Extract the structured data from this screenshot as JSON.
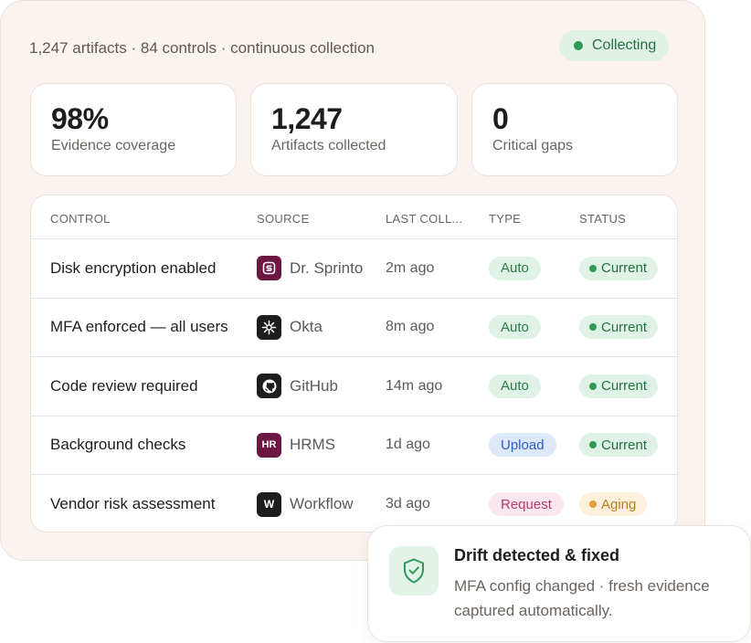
{
  "header": {
    "summary": "1,247 artifacts · 84 controls · continuous collection",
    "badge": "Collecting"
  },
  "stats": [
    {
      "value": "98%",
      "label": "Evidence coverage"
    },
    {
      "value": "1,247",
      "label": "Artifacts collected"
    },
    {
      "value": "0",
      "label": "Critical gaps"
    }
  ],
  "table": {
    "columns": [
      "CONTROL",
      "SOURCE",
      "LAST COLL...",
      "TYPE",
      "STATUS"
    ],
    "rows": [
      {
        "control": "Disk encryption enabled",
        "source": "Dr. Sprinto",
        "source_icon": "sprinto-logo-icon",
        "last": "2m ago",
        "type": "Auto",
        "status": "Current"
      },
      {
        "control": "MFA enforced — all users",
        "source": "Okta",
        "source_icon": "okta-logo-icon",
        "last": "8m ago",
        "type": "Auto",
        "status": "Current"
      },
      {
        "control": "Code review required",
        "source": "GitHub",
        "source_icon": "github-logo-icon",
        "last": "14m ago",
        "type": "Auto",
        "status": "Current"
      },
      {
        "control": "Background checks",
        "source": "HRMS",
        "source_icon": "hrms-logo-icon",
        "source_abbr": "HR",
        "last": "1d ago",
        "type": "Upload",
        "status": "Current"
      },
      {
        "control": "Vendor risk assessment",
        "source": "Workflow",
        "source_icon": "workflow-logo-icon",
        "source_abbr": "W",
        "last": "3d ago",
        "type": "Request",
        "status": "Aging"
      }
    ]
  },
  "toast": {
    "icon": "shield-check-icon",
    "title": "Drift detected & fixed",
    "body": "MFA config changed · fresh evidence captured automatically."
  },
  "colors": {
    "panel_bg": "#faf3ef",
    "success": "#2f9a58",
    "warning": "#e0a13a",
    "sprinto": "#6e1642",
    "dark_icon": "#1f1d1c"
  }
}
